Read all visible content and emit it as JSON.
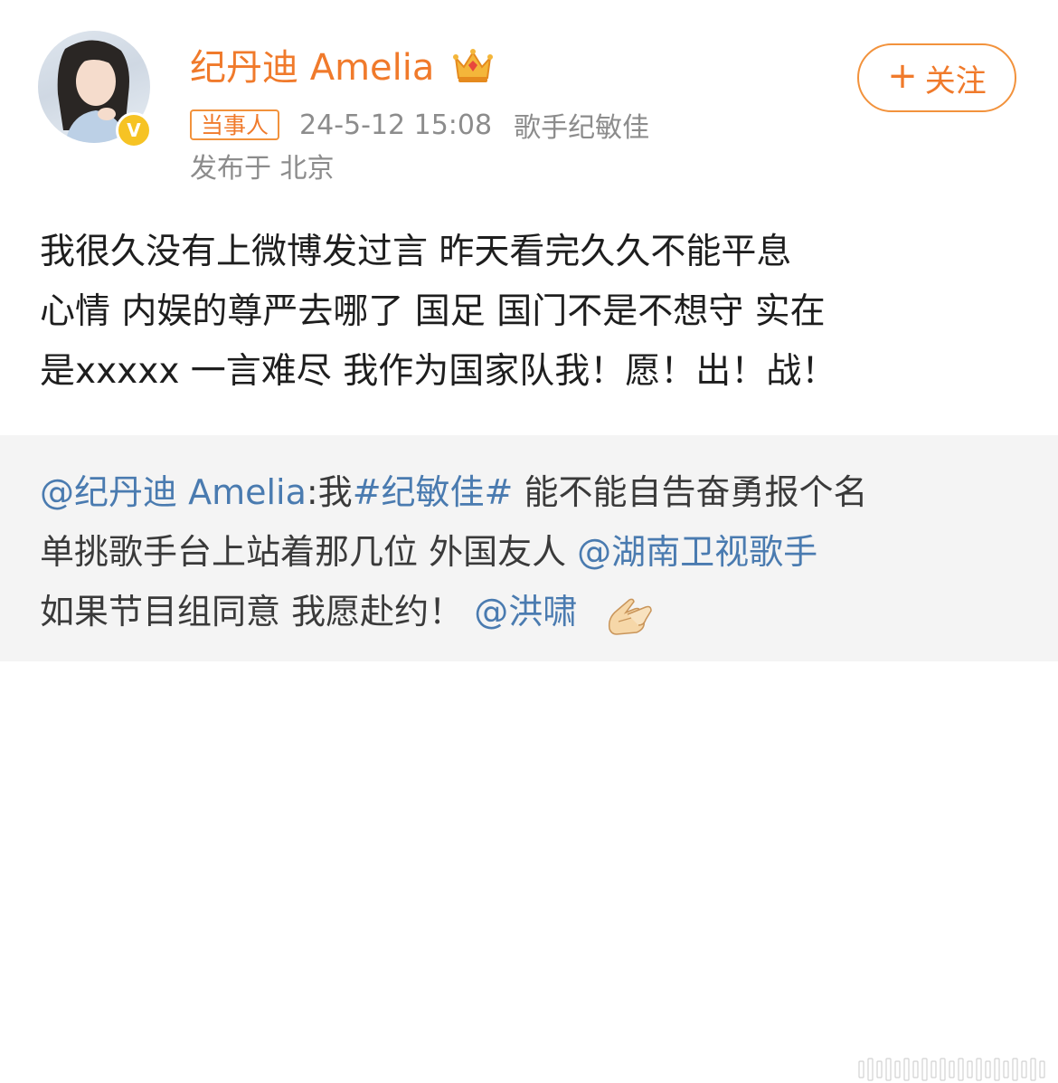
{
  "post": {
    "username": "纪丹迪 Amelia",
    "follow_label": "关注",
    "tag": "当事人",
    "timestamp": "24-5-12 15:08",
    "source": "歌手纪敏佳",
    "location": "发布于 北京",
    "content_lines": [
      "我很久没有上微博发过言  昨天看完久久不能平息",
      "心情 内娱的尊严去哪了 国足 国门不是不想守 实在",
      "是xxxxx 一言难尽 我作为国家队我！愿！出！战！"
    ]
  },
  "repost": {
    "line1_mention": "@纪丹迪 Amelia",
    "line1_colon": ":我",
    "line1_hashtag": "#纪敏佳#",
    "line1_rest": " 能不能自告奋勇报个名",
    "line2_text": "单挑歌手台上站着那几位 外国友人  ",
    "line2_mention": "@湖南卫视歌手",
    "line3_text": "如果节目组同意 我愿赴约！",
    "line3_mention": "@洪啸"
  },
  "icons": {
    "verified": "verified-v-badge-icon",
    "crown": "crown-icon",
    "plus": "plus-icon",
    "emoji": "please-hands-emoji-icon"
  },
  "colors": {
    "accent": "#f07a2b",
    "link": "#4a7bb0",
    "meta": "#8c8c8c",
    "repost_bg": "#f4f4f4"
  }
}
